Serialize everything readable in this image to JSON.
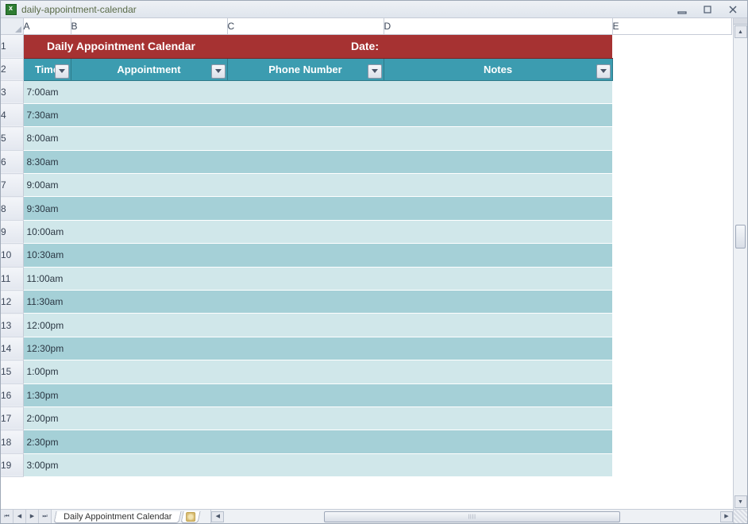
{
  "window": {
    "title": "daily-appointment-calendar"
  },
  "columns": [
    "A",
    "B",
    "C",
    "D",
    "E"
  ],
  "title_row": {
    "left": "Daily Appointment Calendar",
    "right": "Date:"
  },
  "headers": {
    "time": "Time",
    "appointment": "Appointment",
    "phone": "Phone Number",
    "notes": "Notes"
  },
  "rows": [
    {
      "n": 3,
      "time": "7:00am"
    },
    {
      "n": 4,
      "time": "7:30am"
    },
    {
      "n": 5,
      "time": "8:00am"
    },
    {
      "n": 6,
      "time": "8:30am"
    },
    {
      "n": 7,
      "time": "9:00am"
    },
    {
      "n": 8,
      "time": "9:30am"
    },
    {
      "n": 9,
      "time": "10:00am"
    },
    {
      "n": 10,
      "time": "10:30am"
    },
    {
      "n": 11,
      "time": "11:00am"
    },
    {
      "n": 12,
      "time": "11:30am"
    },
    {
      "n": 13,
      "time": "12:00pm"
    },
    {
      "n": 14,
      "time": "12:30pm"
    },
    {
      "n": 15,
      "time": "1:00pm"
    },
    {
      "n": 16,
      "time": "1:30pm"
    },
    {
      "n": 17,
      "time": "2:00pm"
    },
    {
      "n": 18,
      "time": "2:30pm"
    },
    {
      "n": 19,
      "time": "3:00pm"
    }
  ],
  "sheet_tab": "Daily Appointment Calendar"
}
